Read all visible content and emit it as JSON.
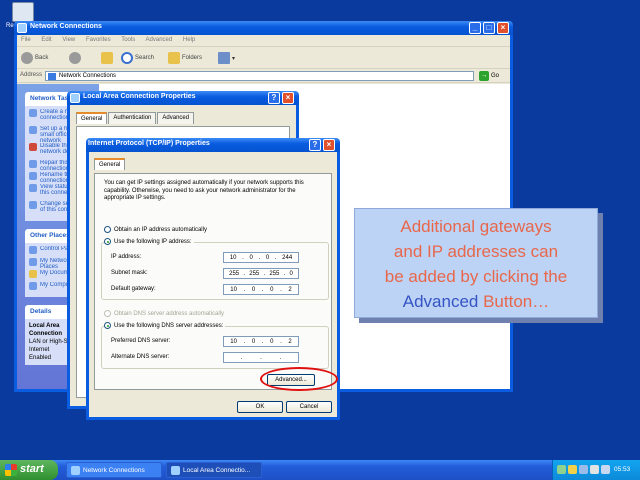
{
  "desktop": {
    "icon_label": "Re"
  },
  "explorer": {
    "title": "Network Connections",
    "menu": [
      "File",
      "Edit",
      "View",
      "Favorites",
      "Tools",
      "Advanced",
      "Help"
    ],
    "toolbar": {
      "back": "Back",
      "search": "Search",
      "folders": "Folders"
    },
    "address_label": "Address",
    "address_value": "Network Connections",
    "go_label": "Go",
    "sidebar": {
      "network_tasks_header": "Network Tasks",
      "network_tasks": [
        "Create a new connection",
        "Set up a home or small office network",
        "Disable this network device",
        "Repair this connection",
        "Rename this connection",
        "View status of this connection",
        "Change settings of this connection"
      ],
      "other_places_header": "Other Places",
      "other_places": [
        "Control Panel",
        "My Network Places",
        "My Documents",
        "My Computer"
      ],
      "details_header": "Details",
      "details_lines": [
        "Local Area Connection",
        "LAN or High-Speed Internet",
        "Enabled"
      ]
    }
  },
  "lan_dialog": {
    "title": "Local Area Connection Properties",
    "tabs": [
      "General",
      "Authentication",
      "Advanced"
    ]
  },
  "tcp_dialog": {
    "title": "Internet Protocol (TCP/IP) Properties",
    "tab": "General",
    "description": "You can get IP settings assigned automatically if your network supports this capability. Otherwise, you need to ask your network administrator for the appropriate IP settings.",
    "radio_auto_ip": "Obtain an IP address automatically",
    "radio_static_ip": "Use the following IP address:",
    "ip_label": "IP address:",
    "ip_value": [
      "10",
      "0",
      "0",
      "244"
    ],
    "mask_label": "Subnet mask:",
    "mask_value": [
      "255",
      "255",
      "255",
      "0"
    ],
    "gateway_label": "Default gateway:",
    "gateway_value": [
      "10",
      "0",
      "0",
      "2"
    ],
    "radio_auto_dns": "Obtain DNS server address automatically",
    "radio_static_dns": "Use the following DNS server addresses:",
    "pref_dns_label": "Preferred DNS server:",
    "pref_dns_value": [
      "10",
      "0",
      "0",
      "2"
    ],
    "alt_dns_label": "Alternate DNS server:",
    "alt_dns_value": [
      "",
      "",
      "",
      ""
    ],
    "advanced_button": "Advanced...",
    "ok_button": "OK",
    "cancel_button": "Cancel"
  },
  "callout": {
    "line1": "Additional gateways",
    "line2": "and IP addresses can",
    "line3": "be added by clicking the",
    "line4_hl": "Advanced",
    "line4_rest": " Button…"
  },
  "taskbar": {
    "start": "start",
    "items": [
      "Network Connections",
      "Local Area Connectio..."
    ],
    "clock": "05:53"
  }
}
